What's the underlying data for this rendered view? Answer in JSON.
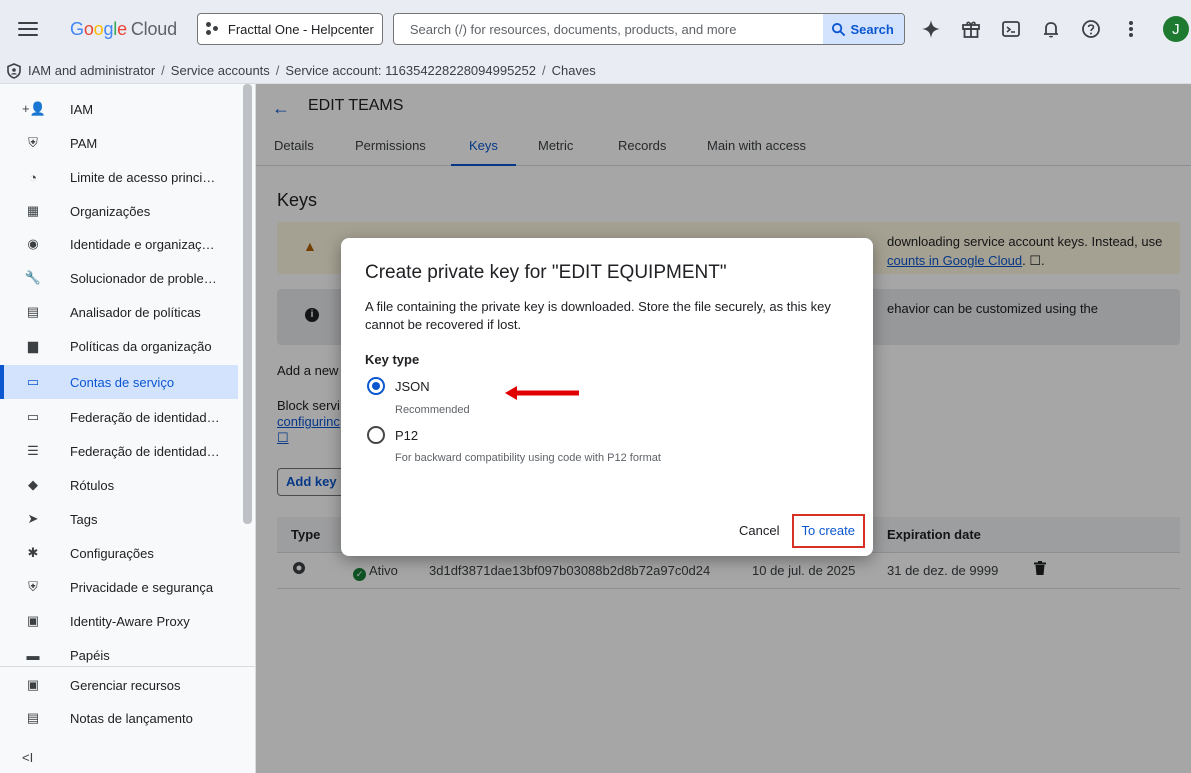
{
  "topbar": {
    "logo_letters": [
      "G",
      "o",
      "o",
      "g",
      "l",
      "e"
    ],
    "logo_suffix": "Cloud",
    "project": "Fracttal One - Helpcenter",
    "search_placeholder": "Search (/) for resources, documents, products, and more",
    "search_button": "Search",
    "avatar_initial": "J"
  },
  "breadcrumb": {
    "items": [
      "IAM and administrator",
      "Service accounts",
      "Service account: 116354228228094995252",
      "Chaves"
    ]
  },
  "sidebar": {
    "items": [
      {
        "icon": "+👤",
        "label": "IAM"
      },
      {
        "icon": "⛨",
        "label": "PAM"
      },
      {
        "icon": "◔",
        "label": "Limite de acesso princi…"
      },
      {
        "icon": "▦",
        "label": "Organizações"
      },
      {
        "icon": "◉",
        "label": "Identidade e organizaç…"
      },
      {
        "icon": "🔧",
        "label": "Solucionador de proble…"
      },
      {
        "icon": "▤",
        "label": "Analisador de políticas"
      },
      {
        "icon": "▆",
        "label": "Políticas da organização"
      },
      {
        "icon": "▭",
        "label": "Contas de serviço"
      },
      {
        "icon": "▭",
        "label": "Federação de identidad…"
      },
      {
        "icon": "☰",
        "label": "Federação de identidad…"
      },
      {
        "icon": "◆",
        "label": "Rótulos"
      },
      {
        "icon": "➤",
        "label": "Tags"
      },
      {
        "icon": "✱",
        "label": "Configurações"
      },
      {
        "icon": "⛨",
        "label": "Privacidade e segurança"
      },
      {
        "icon": "▣",
        "label": "Identity-Aware Proxy"
      },
      {
        "icon": "▬",
        "label": "Papéis"
      },
      {
        "icon": "▣",
        "label": "Gerenciar recursos"
      },
      {
        "icon": "▤",
        "label": "Notas de lançamento"
      }
    ],
    "active_index": 8,
    "collapse_label": "<I"
  },
  "main": {
    "page_title": "EDIT TEAMS",
    "tabs": [
      "Details",
      "Permissions",
      "Keys",
      "Metric",
      "Records",
      "Main with access"
    ],
    "active_tab": 2,
    "section_title": "Keys",
    "warning_line1": "Service account keys can pose a security risk if compromised. We recommend avoiding downloading service account keys. Instead, use",
    "warning_visible_right1": "downloading service account keys. Instead, use",
    "warning_link": "counts in Google Cloud",
    "warning_link_suffix": ". ☐.",
    "info_visible_right": "ehavior can be customized using the",
    "add_new_text": "Add a new",
    "block_text": "Block servi",
    "block_link": "configurinc",
    "block_icon": "☐",
    "add_key_button": "Add key",
    "table": {
      "headers": [
        "Type",
        "Expiration date"
      ],
      "rows": [
        {
          "status": "Ativo",
          "key_id": "3d1df3871dae13bf097b03088b2d8b72a97c0d24",
          "created": "10 de jul. de 2025",
          "expires": "31 de dez. de 9999"
        }
      ]
    }
  },
  "dialog": {
    "title": "Create private key for \"EDIT EQUIPMENT\"",
    "body": "A file containing the private key is downloaded. Store the file securely, as this key cannot be recovered if lost.",
    "key_type_label": "Key type",
    "options": [
      {
        "label": "JSON",
        "hint": "Recommended",
        "checked": true
      },
      {
        "label": "P12",
        "hint": "For backward compatibility using code with P12 format",
        "checked": false
      }
    ],
    "cancel_label": "Cancel",
    "create_label": "To create"
  },
  "colors": {
    "accent": "#0b57d0",
    "annotation_red": "#e00000",
    "highlight_border": "#d93025"
  }
}
